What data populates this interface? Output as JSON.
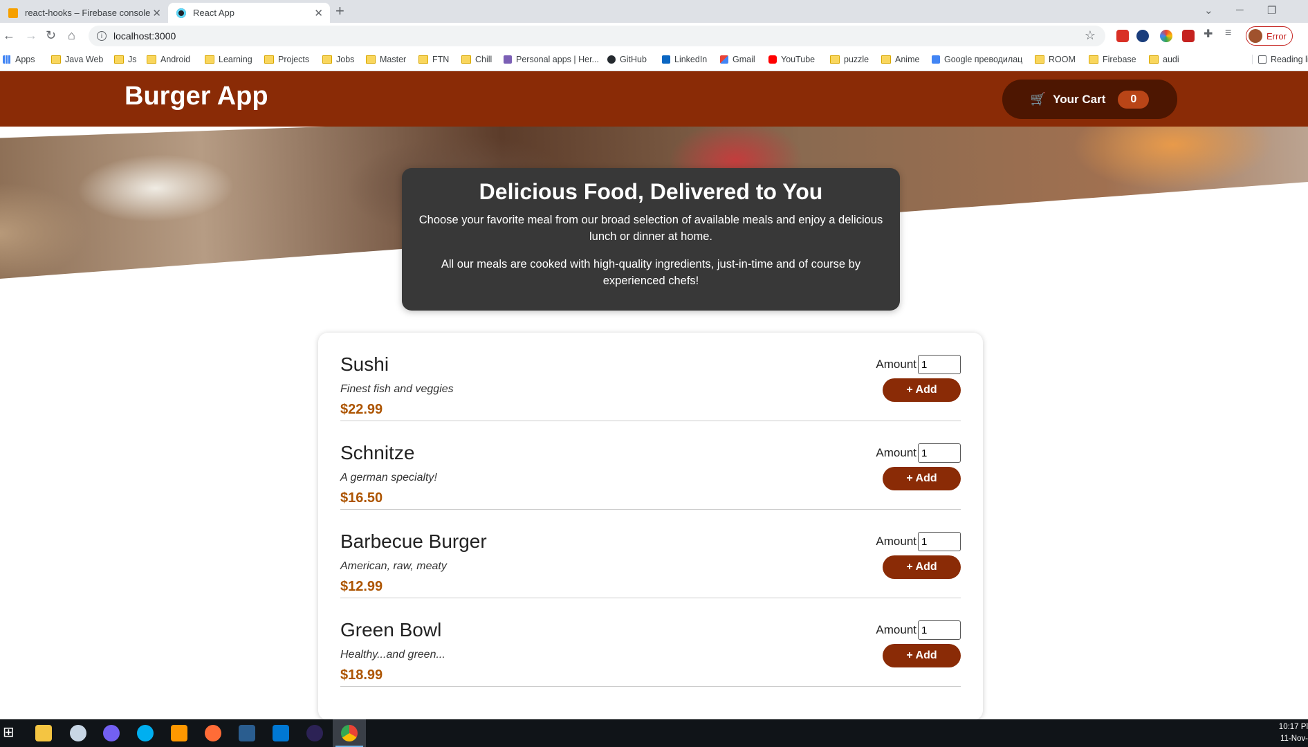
{
  "browser": {
    "tabs": [
      {
        "title": "react-hooks – Firebase console",
        "active": false
      },
      {
        "title": "React App",
        "active": true
      }
    ],
    "address": "localhost:3000",
    "profile_label": "Error",
    "bookmarks": [
      "Apps",
      "Java Web",
      "Js",
      "Android",
      "Learning",
      "Projects",
      "Jobs",
      "Master",
      "FTN",
      "Chill",
      "Personal apps | Her...",
      "GitHub",
      "LinkedIn",
      "Gmail",
      "YouTube",
      "puzzle",
      "Anime",
      "Google преводилац",
      "ROOM",
      "Firebase",
      "audi"
    ],
    "reading_list": "Reading lis"
  },
  "header": {
    "brand": "Burger App",
    "cart_label": "Your Cart",
    "cart_count": "0"
  },
  "summary": {
    "title": "Delicious Food, Delivered to You",
    "p1": "Choose your favorite meal from our broad selection of available meals and enjoy a delicious lunch or dinner at home.",
    "p2": "All our meals are cooked with high-quality ingredients, just-in-time and of course by experienced chefs!"
  },
  "meals": [
    {
      "name": "Sushi",
      "description": "Finest fish and veggies",
      "price": "$22.99",
      "amount_label": "Amount",
      "amount": "1",
      "add_label": "+ Add"
    },
    {
      "name": "Schnitze",
      "description": "A german specialty!",
      "price": "$16.50",
      "amount_label": "Amount",
      "amount": "1",
      "add_label": "+ Add"
    },
    {
      "name": "Barbecue Burger",
      "description": "American, raw, meaty",
      "price": "$12.99",
      "amount_label": "Amount",
      "amount": "1",
      "add_label": "+ Add"
    },
    {
      "name": "Green Bowl",
      "description": "Healthy...and green...",
      "price": "$18.99",
      "amount_label": "Amount",
      "amount": "1",
      "add_label": "+ Add"
    }
  ],
  "taskbar": {
    "time": "10:17 Pl",
    "date": "11-Nov-"
  },
  "colors": {
    "header_bg": "#8a2b06",
    "cart_bg": "#4d1601",
    "badge_bg": "#b94517",
    "price": "#ad5502",
    "summary_bg": "#383838"
  }
}
